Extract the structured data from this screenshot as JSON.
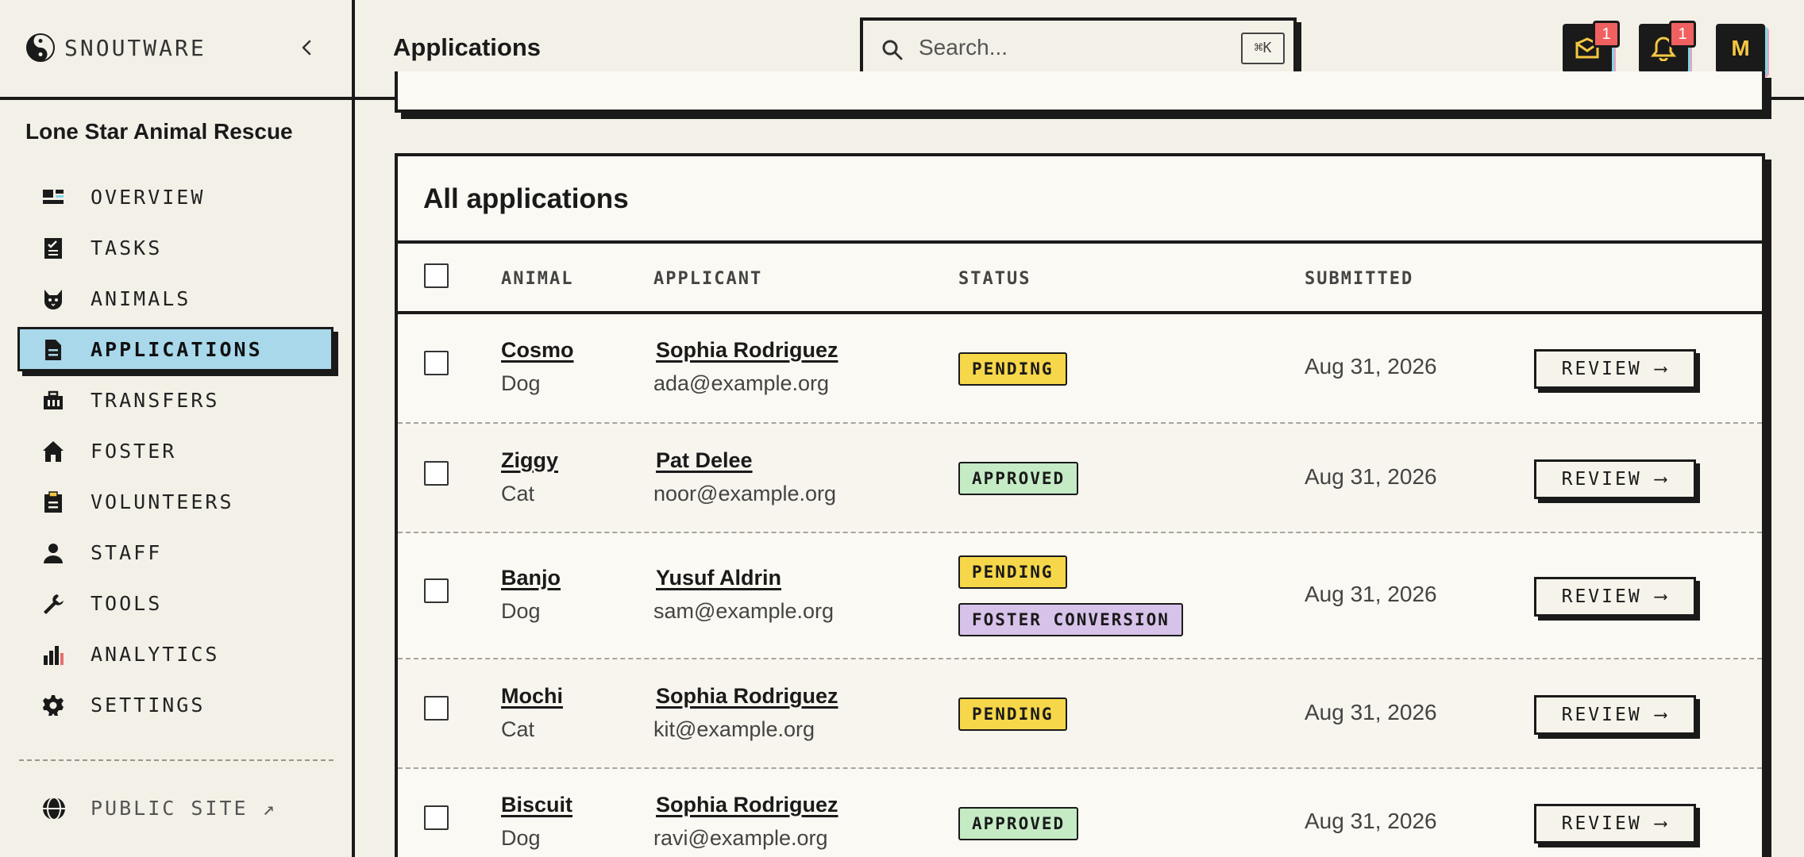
{
  "brand": {
    "name": "SNOUTWARE"
  },
  "org": {
    "name": "Lone Star Animal Rescue"
  },
  "nav": {
    "items": [
      {
        "label": "OVERVIEW",
        "icon": "overview-icon"
      },
      {
        "label": "TASKS",
        "icon": "tasks-icon"
      },
      {
        "label": "ANIMALS",
        "icon": "animals-icon"
      },
      {
        "label": "APPLICATIONS",
        "icon": "applications-icon",
        "active": true
      },
      {
        "label": "TRANSFERS",
        "icon": "transfers-icon"
      },
      {
        "label": "FOSTER",
        "icon": "foster-icon"
      },
      {
        "label": "VOLUNTEERS",
        "icon": "volunteers-icon"
      },
      {
        "label": "STAFF",
        "icon": "staff-icon"
      },
      {
        "label": "TOOLS",
        "icon": "tools-icon"
      },
      {
        "label": "ANALYTICS",
        "icon": "analytics-icon"
      },
      {
        "label": "SETTINGS",
        "icon": "settings-icon"
      }
    ],
    "public_site": "PUBLIC SITE ↗"
  },
  "header": {
    "title": "Applications",
    "search_placeholder": "Search...",
    "search_shortcut": "⌘K",
    "inbox_count": "1",
    "notifications_count": "1",
    "avatar_initial": "M"
  },
  "card": {
    "title": "All applications",
    "columns": {
      "animal": "ANIMAL",
      "applicant": "APPLICANT",
      "status": "STATUS",
      "submitted": "SUBMITTED"
    }
  },
  "rows": [
    {
      "animal": "Cosmo",
      "type": "Dog",
      "applicant": "Sophia Rodriguez",
      "email": "ada@example.org",
      "status": [
        "PENDING"
      ],
      "date": "Aug 31, 2026",
      "action": "REVIEW ⟶"
    },
    {
      "animal": "Ziggy",
      "type": "Cat",
      "applicant": "Pat Delee",
      "email": "noor@example.org",
      "status": [
        "APPROVED"
      ],
      "date": "Aug 31, 2026",
      "action": "REVIEW ⟶"
    },
    {
      "animal": "Banjo",
      "type": "Dog",
      "applicant": "Yusuf Aldrin",
      "email": "sam@example.org",
      "status": [
        "PENDING",
        "FOSTER CONVERSION"
      ],
      "date": "Aug 31, 2026",
      "action": "REVIEW ⟶"
    },
    {
      "animal": "Mochi",
      "type": "Cat",
      "applicant": "Sophia Rodriguez",
      "email": "kit@example.org",
      "status": [
        "PENDING"
      ],
      "date": "Aug 31, 2026",
      "action": "REVIEW ⟶"
    },
    {
      "animal": "Biscuit",
      "type": "Dog",
      "applicant": "Sophia Rodriguez",
      "email": "ravi@example.org",
      "status": [
        "APPROVED"
      ],
      "date": "Aug 31, 2026",
      "action": "REVIEW ⟶"
    }
  ],
  "colors": {
    "accent": "#a8d8ea",
    "pending": "#f7d74a",
    "approved": "#c5ebc5",
    "foster": "#d7c2ea",
    "badge": "#f06060",
    "ink": "#1a1a1a"
  }
}
